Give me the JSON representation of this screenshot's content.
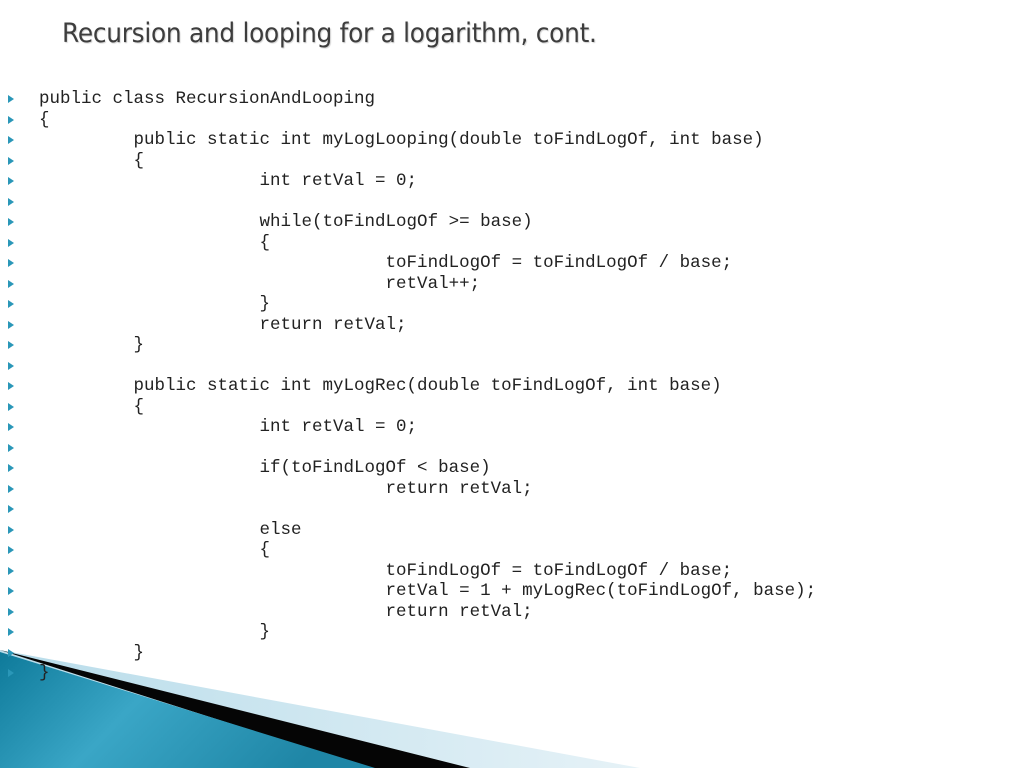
{
  "slide": {
    "title": "Recursion and looping for a logarithm, cont.",
    "bullet_icon": "triangle-right-bullet",
    "accent_color": "#2a97b8",
    "code_lines": [
      "public class RecursionAndLooping",
      "{",
      "         public static int myLogLooping(double toFindLogOf, int base)",
      "         {",
      "                     int retVal = 0;",
      "",
      "                     while(toFindLogOf >= base)",
      "                     {",
      "                                 toFindLogOf = toFindLogOf / base;",
      "                                 retVal++;",
      "                     }",
      "                     return retVal;",
      "         }",
      "",
      "         public static int myLogRec(double toFindLogOf, int base)",
      "         {",
      "                     int retVal = 0;",
      "",
      "                     if(toFindLogOf < base)",
      "                                 return retVal;",
      "",
      "                     else",
      "                     {",
      "                                 toFindLogOf = toFindLogOf / base;",
      "                                 retVal = 1 + myLogRec(toFindLogOf, base);",
      "                                 return retVal;",
      "                     }",
      "         }",
      "}"
    ]
  }
}
